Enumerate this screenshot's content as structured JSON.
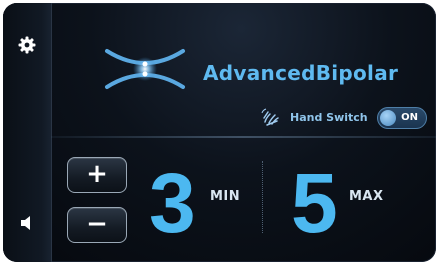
{
  "sidebar": {
    "settings_icon": "gear-icon",
    "sound_icon": "speaker-icon"
  },
  "header": {
    "mode_icon": "bipolar-forceps-icon",
    "mode_title": "AdvancedBipolar"
  },
  "hand_switch": {
    "icon": "hand-icon",
    "label": "Hand Switch",
    "toggle_state": "ON"
  },
  "power": {
    "plus_label": "+",
    "minus_label": "−",
    "min_value": "3",
    "min_unit": "MIN",
    "max_value": "5",
    "max_unit": "MAX"
  },
  "colors": {
    "accent": "#4cb8f0",
    "title": "#5fbaf0",
    "background": "#0c121b"
  }
}
